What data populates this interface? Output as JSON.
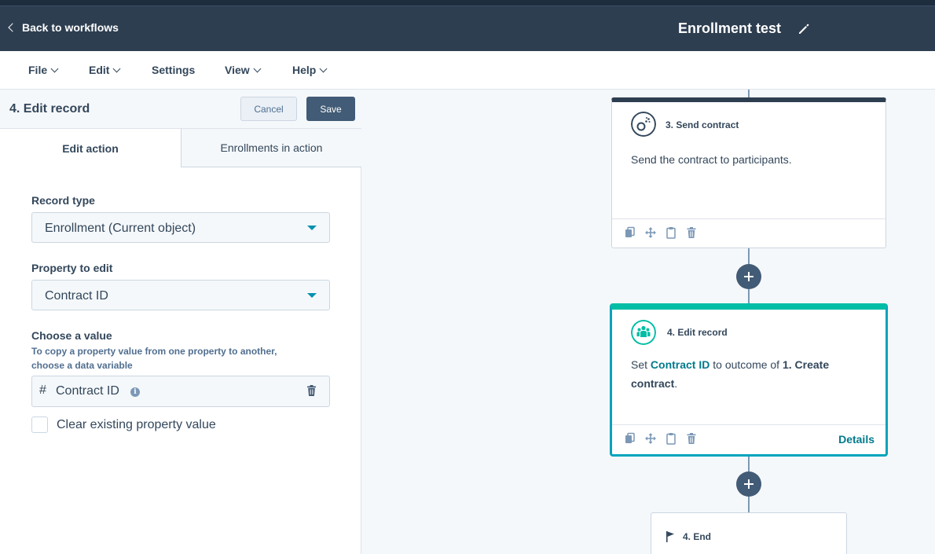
{
  "header": {
    "back_label": "Back to workflows",
    "workflow_title": "Enrollment test"
  },
  "menu": {
    "items": [
      {
        "label": "File",
        "has_caret": true
      },
      {
        "label": "Edit",
        "has_caret": true
      },
      {
        "label": "Settings",
        "has_caret": false
      },
      {
        "label": "View",
        "has_caret": true
      },
      {
        "label": "Help",
        "has_caret": true
      }
    ]
  },
  "panel": {
    "title": "4. Edit record",
    "cancel_label": "Cancel",
    "save_label": "Save",
    "tabs": [
      {
        "label": "Edit action",
        "active": true
      },
      {
        "label": "Enrollments in action",
        "active": false
      }
    ],
    "record_type": {
      "label": "Record type",
      "value": "Enrollment (Current object)"
    },
    "property": {
      "label": "Property to edit",
      "value": "Contract ID"
    },
    "choose_value": {
      "label": "Choose a value",
      "help_line1": "To copy a property value from one property to another,",
      "help_line2": "choose a data variable",
      "type_symbol": "#",
      "value": "Contract ID"
    },
    "clear_option": {
      "label": "Clear existing property value",
      "checked": false
    }
  },
  "canvas": {
    "send_contract": {
      "title": "3. Send contract",
      "body": "Send the contract to participants.",
      "icon": "contract-icon"
    },
    "edit_record": {
      "title": "4. Edit record",
      "body_prefix": "Set ",
      "body_property": "Contract ID",
      "body_middle": " to outcome of ",
      "body_outcome_line1": "1. Create",
      "body_outcome_line2": "contract",
      "body_suffix": ".",
      "details_label": "Details",
      "icon": "people-icon"
    },
    "end": {
      "title": "4. End",
      "icon": "flag-icon"
    }
  },
  "colors": {
    "header_bg": "#2d3e50",
    "accent_teal": "#00bda5",
    "link_teal": "#007a8c",
    "save_button": "#425b76",
    "connector": "#7c98b6"
  }
}
